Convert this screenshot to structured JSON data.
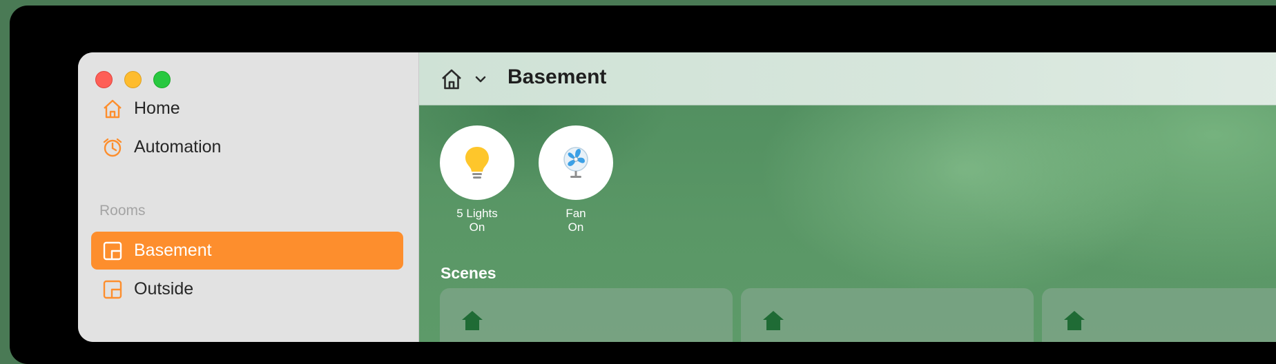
{
  "window": {
    "traffic_lights": [
      "close",
      "minimize",
      "zoom"
    ]
  },
  "sidebar": {
    "items": [
      {
        "label": "Home",
        "icon": "house-icon"
      },
      {
        "label": "Automation",
        "icon": "clock-icon"
      }
    ],
    "rooms_label": "Rooms",
    "rooms": [
      {
        "label": "Basement",
        "icon": "room-icon",
        "selected": true
      },
      {
        "label": "Outside",
        "icon": "room-icon",
        "selected": false
      }
    ],
    "accent_color": "#fd8e2d"
  },
  "toolbar": {
    "title": "Basement"
  },
  "accessories": [
    {
      "line1": "5 Lights",
      "line2": "On",
      "icon": "lightbulb-icon"
    },
    {
      "line1": "Fan",
      "line2": "On",
      "icon": "fan-icon"
    }
  ],
  "scenes": {
    "label": "Scenes",
    "card_count_visible": 3
  }
}
